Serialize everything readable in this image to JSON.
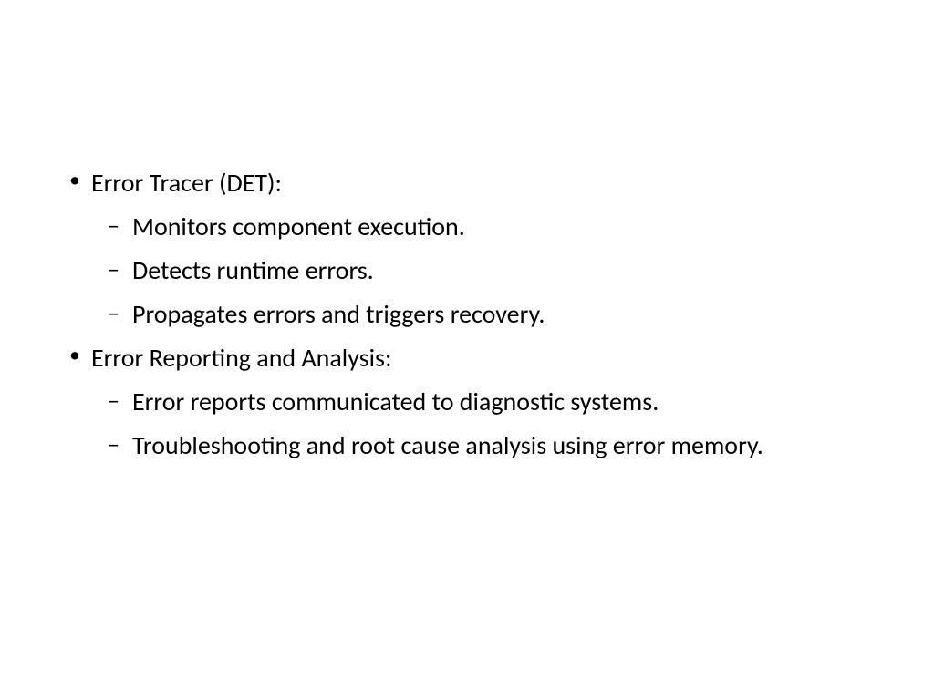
{
  "slide": {
    "items": [
      {
        "label": "Error Tracer (DET):",
        "subitems": [
          "Monitors component execution.",
          "Detects runtime errors.",
          "Propagates errors and triggers recovery."
        ]
      },
      {
        "label": "Error Reporting and Analysis:",
        "subitems": [
          "Error reports communicated to diagnostic systems.",
          "Troubleshooting and root cause analysis using error memory."
        ]
      }
    ]
  }
}
